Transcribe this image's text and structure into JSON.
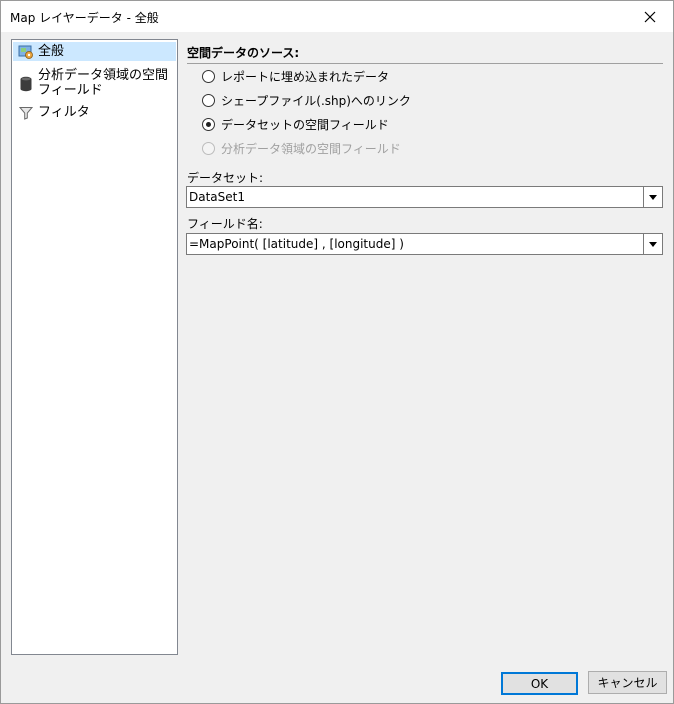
{
  "window": {
    "title": "Map レイヤーデータ - 全般",
    "close_icon": "close-icon"
  },
  "nav": {
    "items": [
      {
        "label": "全般",
        "icon": "map-layer-icon",
        "selected": true
      },
      {
        "label": "分析データ領域の空間\nフィールド",
        "icon": "database-icon",
        "selected": false
      },
      {
        "label": "フィルタ",
        "icon": "filter-icon",
        "selected": false
      }
    ]
  },
  "source": {
    "title": "空間データのソース:",
    "options": [
      {
        "label": "レポートに埋め込まれたデータ",
        "checked": false,
        "disabled": false
      },
      {
        "label": "シェープファイル(.shp)へのリンク",
        "checked": false,
        "disabled": false
      },
      {
        "label": "データセットの空間フィールド",
        "checked": true,
        "disabled": false
      },
      {
        "label": "分析データ領域の空間フィールド",
        "checked": false,
        "disabled": true
      }
    ]
  },
  "dataset": {
    "label": "データセット:",
    "value": "DataSet1"
  },
  "field": {
    "label": "フィールド名:",
    "value": "=MapPoint( [latitude] , [longitude] )"
  },
  "buttons": {
    "ok": "OK",
    "cancel": "キャンセル"
  }
}
